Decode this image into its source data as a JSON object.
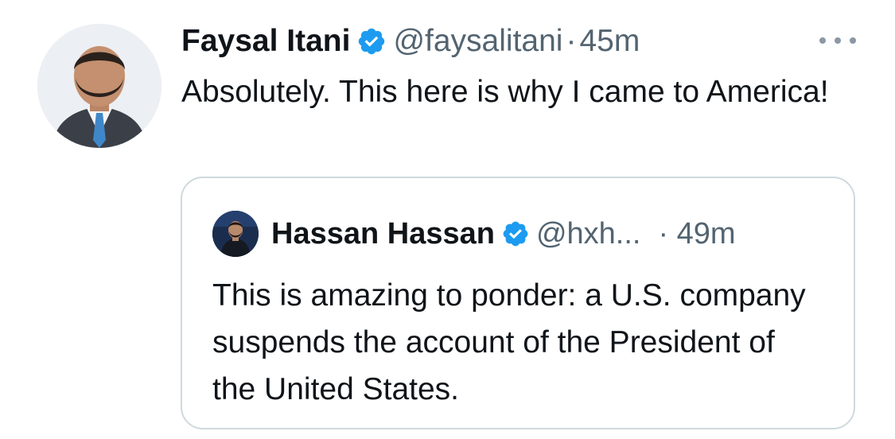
{
  "tweet": {
    "author_name": "Faysal Itani",
    "handle": "@faysalitani",
    "separator": "·",
    "time": "45m",
    "text": "Absolutely. This here is why I came to America!"
  },
  "quoted_tweet": {
    "author_name": "Hassan Hassan",
    "handle": "@hxh...",
    "time": "· 49m",
    "text": "This is amazing to ponder: a U.S. company suspends the account of the President of the United States."
  },
  "icons": {
    "verified": "verified-badge-icon",
    "more": "more-options-icon"
  },
  "colors": {
    "text": "#0f1419",
    "secondary": "#536471",
    "verified": "#1d9bf0",
    "border": "#cfd9de"
  }
}
